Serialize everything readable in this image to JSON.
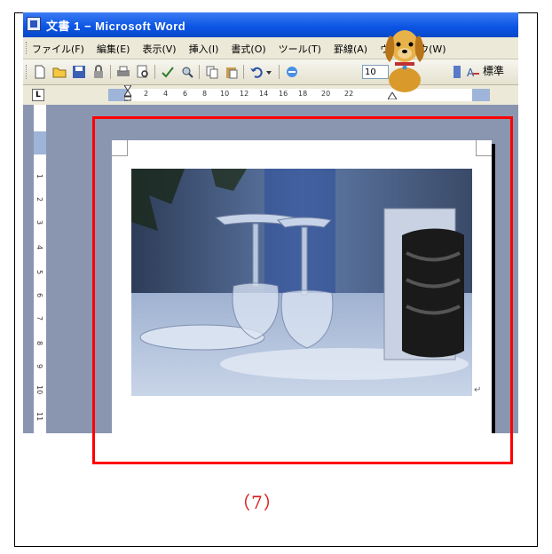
{
  "window": {
    "title": "文書 1 − Microsoft Word"
  },
  "menu": {
    "items": [
      "ファイル(F)",
      "編集(E)",
      "表示(V)",
      "挿入(I)",
      "書式(O)",
      "ツール(T)",
      "罫線(A)",
      "ウィンドウ(W)"
    ]
  },
  "toolbar": {
    "zoom": "10",
    "style": "標準"
  },
  "ruler": {
    "h_numbers": [
      "2",
      "4",
      "6",
      "8",
      "10",
      "12",
      "14",
      "16",
      "18",
      "20",
      "22"
    ],
    "v_numbers": [
      "1",
      "2",
      "3",
      "4",
      "5",
      "6",
      "7",
      "8",
      "9",
      "10",
      "11"
    ]
  },
  "colors": {
    "highlight": "#ff0000",
    "caption": "#d91a1a",
    "titlebar": "#0a54e2"
  },
  "caption": "（7）"
}
